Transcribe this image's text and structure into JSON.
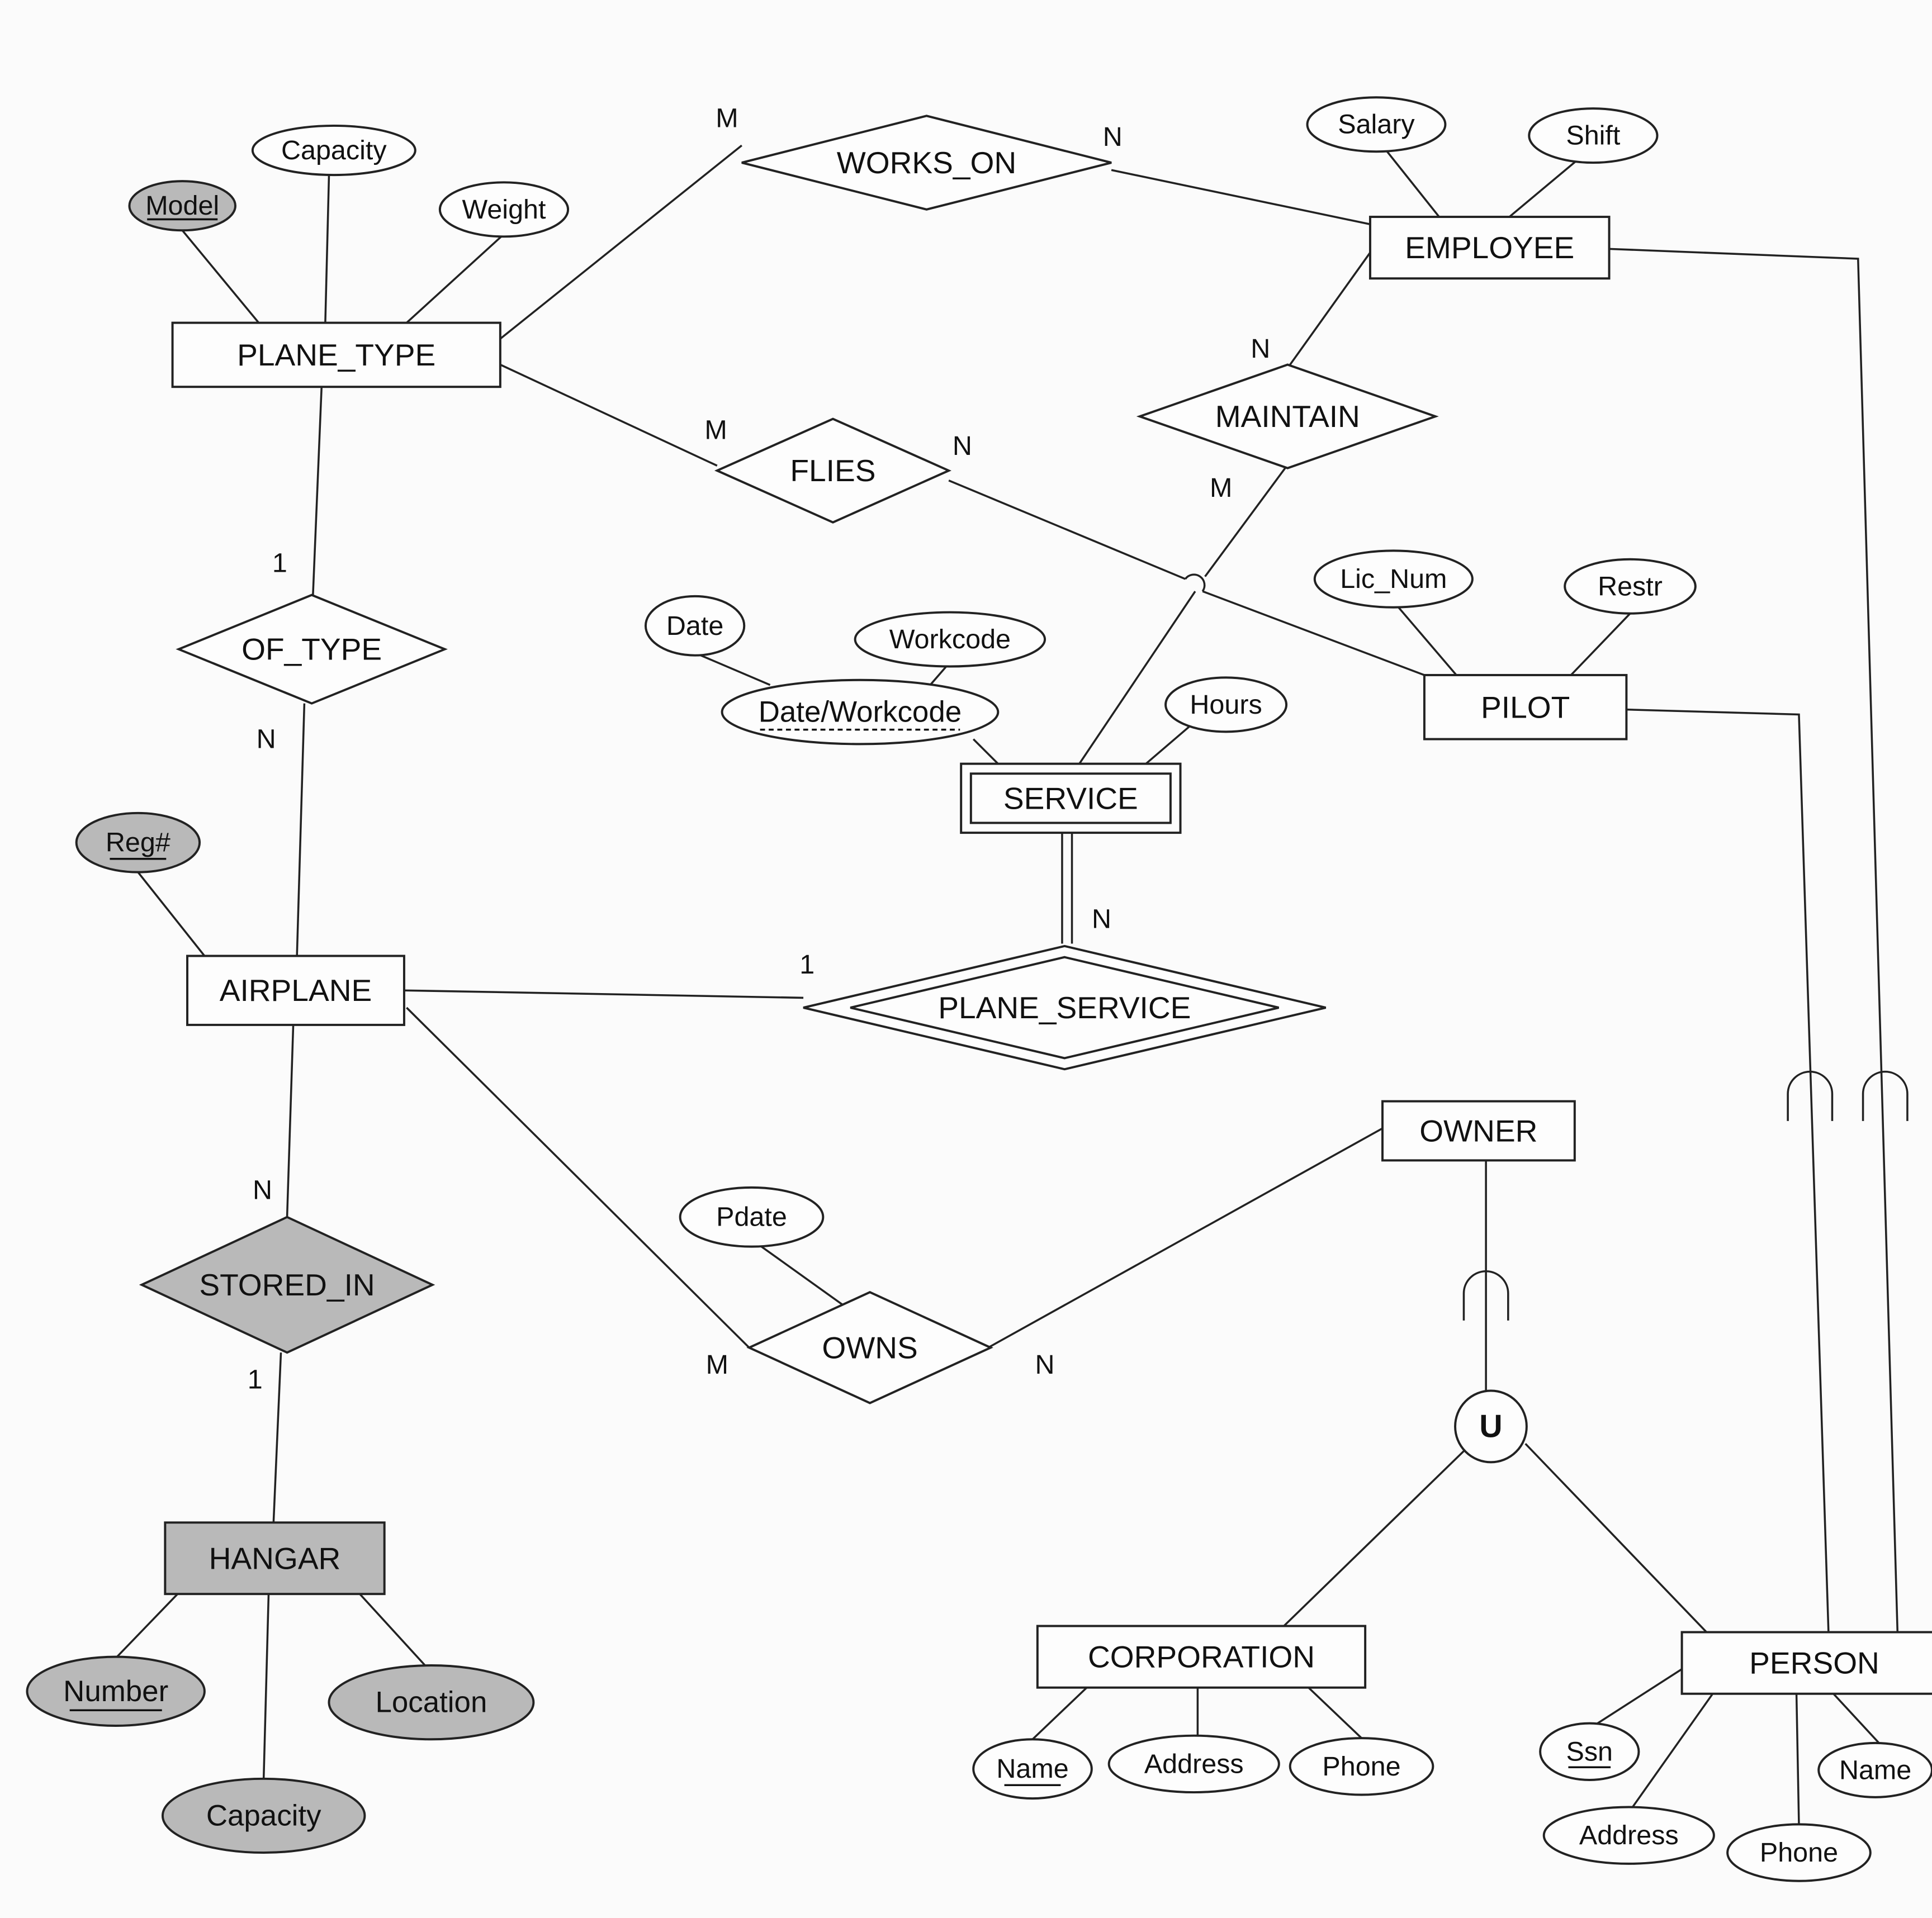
{
  "entities": [
    {
      "id": "plane_type",
      "label": "PLANE_TYPE",
      "weak": false,
      "shaded": false
    },
    {
      "id": "employee",
      "label": "EMPLOYEE",
      "weak": false,
      "shaded": false
    },
    {
      "id": "pilot",
      "label": "PILOT",
      "weak": false,
      "shaded": false
    },
    {
      "id": "service",
      "label": "SERVICE",
      "weak": true,
      "shaded": false
    },
    {
      "id": "airplane",
      "label": "AIRPLANE",
      "weak": false,
      "shaded": false
    },
    {
      "id": "owner",
      "label": "OWNER",
      "weak": false,
      "shaded": false
    },
    {
      "id": "hangar",
      "label": "HANGAR",
      "weak": false,
      "shaded": true
    },
    {
      "id": "corporation",
      "label": "CORPORATION",
      "weak": false,
      "shaded": false
    },
    {
      "id": "person",
      "label": "PERSON",
      "weak": false,
      "shaded": false
    }
  ],
  "relationships": [
    {
      "id": "works_on",
      "label": "WORKS_ON",
      "identifying": false,
      "shaded": false
    },
    {
      "id": "flies",
      "label": "FLIES",
      "identifying": false,
      "shaded": false
    },
    {
      "id": "maintain",
      "label": "MAINTAIN",
      "identifying": false,
      "shaded": false
    },
    {
      "id": "of_type",
      "label": "OF_TYPE",
      "identifying": false,
      "shaded": false
    },
    {
      "id": "plane_service",
      "label": "PLANE_SERVICE",
      "identifying": true,
      "shaded": false
    },
    {
      "id": "owns",
      "label": "OWNS",
      "identifying": false,
      "shaded": false
    },
    {
      "id": "stored_in",
      "label": "STORED_IN",
      "identifying": false,
      "shaded": true
    }
  ],
  "attributes": [
    {
      "id": "pt_model",
      "label": "Model",
      "key": "full",
      "shaded": true
    },
    {
      "id": "pt_capacity",
      "label": "Capacity",
      "key": "none",
      "shaded": false
    },
    {
      "id": "pt_weight",
      "label": "Weight",
      "key": "none",
      "shaded": false
    },
    {
      "id": "emp_salary",
      "label": "Salary",
      "key": "none",
      "shaded": false
    },
    {
      "id": "emp_shift",
      "label": "Shift",
      "key": "none",
      "shaded": false
    },
    {
      "id": "pil_licnum",
      "label": "Lic_Num",
      "key": "none",
      "shaded": false
    },
    {
      "id": "pil_restr",
      "label": "Restr",
      "key": "none",
      "shaded": false
    },
    {
      "id": "sv_date",
      "label": "Date",
      "key": "none",
      "shaded": false
    },
    {
      "id": "sv_workcode",
      "label": "Workcode",
      "key": "none",
      "shaded": false
    },
    {
      "id": "sv_dw",
      "label": "Date/Workcode",
      "key": "partial",
      "shaded": false
    },
    {
      "id": "sv_hours",
      "label": "Hours",
      "key": "none",
      "shaded": false
    },
    {
      "id": "ap_reg",
      "label": "Reg#",
      "key": "full",
      "shaded": true
    },
    {
      "id": "ow_pdate",
      "label": "Pdate",
      "key": "none",
      "shaded": false
    },
    {
      "id": "hg_number",
      "label": "Number",
      "key": "full",
      "shaded": true
    },
    {
      "id": "hg_location",
      "label": "Location",
      "key": "none",
      "shaded": true
    },
    {
      "id": "hg_capacity",
      "label": "Capacity",
      "key": "none",
      "shaded": true
    },
    {
      "id": "co_name",
      "label": "Name",
      "key": "full",
      "shaded": false
    },
    {
      "id": "co_address",
      "label": "Address",
      "key": "none",
      "shaded": false
    },
    {
      "id": "co_phone",
      "label": "Phone",
      "key": "none",
      "shaded": false
    },
    {
      "id": "pe_ssn",
      "label": "Ssn",
      "key": "full",
      "shaded": false
    },
    {
      "id": "pe_name",
      "label": "Name",
      "key": "none",
      "shaded": false
    },
    {
      "id": "pe_address",
      "label": "Address",
      "key": "none",
      "shaded": false
    },
    {
      "id": "pe_phone",
      "label": "Phone",
      "key": "none",
      "shaded": false
    }
  ],
  "union": {
    "label": "U"
  },
  "cardinalities": [
    {
      "id": "c1",
      "label": "M"
    },
    {
      "id": "c2",
      "label": "N"
    },
    {
      "id": "c3",
      "label": "M"
    },
    {
      "id": "c4",
      "label": "N"
    },
    {
      "id": "c5",
      "label": "N"
    },
    {
      "id": "c6",
      "label": "M"
    },
    {
      "id": "c7",
      "label": "1"
    },
    {
      "id": "c8",
      "label": "N"
    },
    {
      "id": "c9",
      "label": "N"
    },
    {
      "id": "c10",
      "label": "1"
    },
    {
      "id": "c11",
      "label": "N"
    },
    {
      "id": "c12",
      "label": "1"
    },
    {
      "id": "c13",
      "label": "M"
    },
    {
      "id": "c14",
      "label": "N"
    }
  ]
}
